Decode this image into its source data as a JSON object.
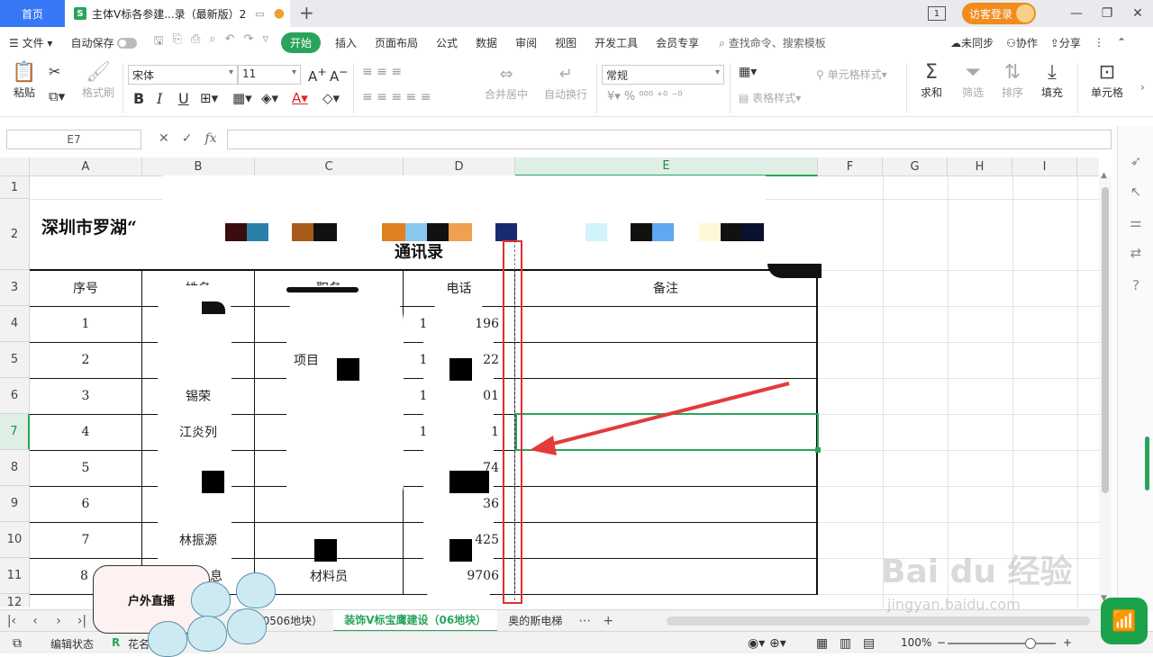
{
  "titlebar": {
    "home_tab": "首页",
    "doc_tab": "主体V标各参建...录（最新版）2",
    "guest_login": "访客登录",
    "window_count": "1"
  },
  "menubar": {
    "file": "文件",
    "autosave": "自动保存",
    "tabs": [
      "开始",
      "插入",
      "页面布局",
      "公式",
      "数据",
      "审阅",
      "视图",
      "开发工具",
      "会员专享"
    ],
    "search": "查找命令、搜索模板",
    "sync": "未同步",
    "collab": "协作",
    "share": "分享"
  },
  "ribbon": {
    "paste": "粘贴",
    "format_painter": "格式刷",
    "font_name": "宋体",
    "font_size": "11",
    "merge_center": "合并居中",
    "wrap_text": "自动换行",
    "number_format": "常规",
    "cell_style": "单元格样式",
    "table_style": "表格样式",
    "sum": "求和",
    "filter": "筛选",
    "sort": "排序",
    "fill": "填充",
    "cell": "单元格"
  },
  "formula": {
    "namebox": "E7",
    "fx": "fx"
  },
  "grid": {
    "columns": [
      "A",
      "B",
      "C",
      "D",
      "E",
      "F",
      "G",
      "H",
      "I"
    ],
    "rows": [
      "1",
      "2",
      "3",
      "4",
      "5",
      "6",
      "7",
      "8",
      "9",
      "10",
      "11",
      "12"
    ],
    "title": "深圳市罗湖“",
    "subtitle": "通讯录",
    "headers": {
      "seq": "序号",
      "name": "姓名",
      "post": "职务",
      "phone": "电话",
      "note": "备注"
    },
    "seq_values": [
      "1",
      "2",
      "3",
      "4",
      "5",
      "6",
      "7",
      "8"
    ],
    "names": [
      "",
      "",
      "锡荣",
      "江炎列",
      "",
      "",
      "林振源",
      "息"
    ],
    "posts": [
      "",
      "项目",
      "",
      "",
      "",
      "",
      "",
      "材料员"
    ],
    "phones": [
      "196",
      "22",
      "01",
      "1",
      "74",
      "36",
      "425",
      "9706"
    ],
    "phone_prefix": [
      "1",
      "1",
      "1",
      "1",
      "",
      "",
      "",
      ""
    ]
  },
  "sheets": {
    "tab_partial": "40506地块）",
    "tab_active": "装饰V标宝鹰建设（06地块）",
    "tab_next": "奥的斯电梯"
  },
  "status": {
    "edit_state": "编辑状态",
    "app_partial": "花名",
    "zoom": "100%"
  },
  "overlay": {
    "live": "户外直播",
    "watermark": "Bai du 经验",
    "watermark_url": "jingyan.baidu.com"
  }
}
